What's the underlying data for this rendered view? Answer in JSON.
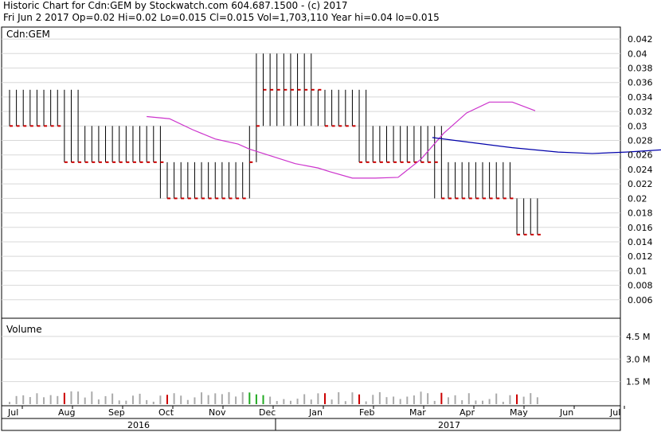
{
  "header": {
    "line1": "Historic Chart for Cdn:GEM by Stockwatch.com 604.687.1500 - (c) 2017",
    "line2": "Fri Jun  2 2017   Op=0.02   Hi=0.02   Lo=0.015   Cl=0.015   Vol=1,703,110   Year hi=0.04   lo=0.015"
  },
  "colors": {
    "price_up": "#000000",
    "price_close": "#cc0000",
    "ma_short": "#cc33cc",
    "ma_long": "#0000aa",
    "volume_flat": "#aaaaaa",
    "volume_up": "#22aa22",
    "volume_down": "#cc0000",
    "grid": "#d8d8d8"
  },
  "chart_data": {
    "type": "line",
    "price_panel": {
      "symbol": "Cdn:GEM",
      "ylim": [
        0.004,
        0.043
      ],
      "y_ticks": [
        "0.042",
        "0.04",
        "0.038",
        "0.036",
        "0.034",
        "0.032",
        "0.03",
        "0.028",
        "0.026",
        "0.024",
        "0.022",
        "0.02",
        "0.018",
        "0.016",
        "0.014",
        "0.012",
        "0.01",
        "0.008",
        "0.006"
      ],
      "price_bars": {
        "day_index": [
          0,
          3,
          6,
          9,
          12,
          15,
          18,
          21,
          24,
          27,
          30,
          33,
          36,
          39,
          42,
          45,
          48,
          51,
          54,
          57,
          60,
          63,
          66,
          69,
          72,
          75,
          78,
          81,
          84,
          87,
          90,
          93,
          96,
          99,
          102,
          105,
          108,
          111,
          114,
          117,
          120,
          123,
          126,
          129,
          132,
          135,
          138,
          141,
          144,
          147,
          150,
          153,
          156,
          159,
          162,
          165,
          168,
          171,
          174,
          177,
          180,
          183,
          186,
          189,
          192,
          195,
          198,
          201,
          204,
          207,
          210,
          213,
          216,
          219,
          222,
          225,
          228,
          231
        ],
        "low": [
          0.03,
          0.03,
          0.03,
          0.03,
          0.03,
          0.03,
          0.03,
          0.03,
          0.025,
          0.025,
          0.025,
          0.025,
          0.025,
          0.025,
          0.025,
          0.025,
          0.025,
          0.025,
          0.025,
          0.025,
          0.025,
          0.025,
          0.02,
          0.02,
          0.02,
          0.02,
          0.02,
          0.02,
          0.02,
          0.02,
          0.02,
          0.02,
          0.02,
          0.02,
          0.02,
          0.02,
          0.025,
          0.03,
          0.03,
          0.03,
          0.03,
          0.03,
          0.03,
          0.03,
          0.03,
          0.03,
          0.03,
          0.03,
          0.03,
          0.03,
          0.03,
          0.025,
          0.025,
          0.025,
          0.025,
          0.025,
          0.025,
          0.025,
          0.025,
          0.025,
          0.025,
          0.025,
          0.02,
          0.02,
          0.02,
          0.02,
          0.02,
          0.02,
          0.02,
          0.02,
          0.02,
          0.02,
          0.02,
          0.02,
          0.015,
          0.015,
          0.015,
          0.015
        ],
        "high": [
          0.035,
          0.035,
          0.035,
          0.035,
          0.035,
          0.035,
          0.035,
          0.035,
          0.035,
          0.035,
          0.035,
          0.03,
          0.03,
          0.03,
          0.03,
          0.03,
          0.03,
          0.03,
          0.03,
          0.03,
          0.03,
          0.03,
          0.03,
          0.025,
          0.025,
          0.025,
          0.025,
          0.025,
          0.025,
          0.025,
          0.025,
          0.025,
          0.025,
          0.025,
          0.025,
          0.03,
          0.04,
          0.04,
          0.04,
          0.04,
          0.04,
          0.04,
          0.04,
          0.04,
          0.04,
          0.035,
          0.035,
          0.035,
          0.035,
          0.035,
          0.035,
          0.035,
          0.035,
          0.03,
          0.03,
          0.03,
          0.03,
          0.03,
          0.03,
          0.03,
          0.03,
          0.03,
          0.03,
          0.03,
          0.025,
          0.025,
          0.025,
          0.025,
          0.025,
          0.025,
          0.025,
          0.025,
          0.025,
          0.025,
          0.02,
          0.02,
          0.02,
          0.02
        ],
        "close": [
          0.03,
          0.03,
          0.03,
          0.03,
          0.03,
          0.03,
          0.03,
          0.03,
          0.025,
          0.025,
          0.025,
          0.025,
          0.025,
          0.025,
          0.025,
          0.025,
          0.025,
          0.025,
          0.025,
          0.025,
          0.025,
          0.025,
          0.025,
          0.02,
          0.02,
          0.02,
          0.02,
          0.02,
          0.02,
          0.02,
          0.02,
          0.02,
          0.02,
          0.02,
          0.02,
          0.025,
          0.03,
          0.035,
          0.035,
          0.035,
          0.035,
          0.035,
          0.035,
          0.035,
          0.035,
          0.035,
          0.03,
          0.03,
          0.03,
          0.03,
          0.03,
          0.025,
          0.025,
          0.025,
          0.025,
          0.025,
          0.025,
          0.025,
          0.025,
          0.025,
          0.025,
          0.025,
          0.025,
          0.02,
          0.02,
          0.02,
          0.02,
          0.02,
          0.02,
          0.02,
          0.02,
          0.02,
          0.02,
          0.02,
          0.015,
          0.015,
          0.015,
          0.015
        ]
      },
      "moving_average_short": {
        "day_index": [
          60,
          70,
          80,
          90,
          100,
          105,
          115,
          125,
          135,
          140,
          150,
          160,
          170,
          180,
          190,
          200,
          210,
          220,
          230
        ],
        "values": [
          0.0313,
          0.031,
          0.0295,
          0.0282,
          0.0275,
          0.0268,
          0.0258,
          0.0248,
          0.0242,
          0.0237,
          0.0228,
          0.0228,
          0.0229,
          0.0254,
          0.029,
          0.0318,
          0.0333,
          0.0333,
          0.0321
        ]
      },
      "moving_average_long": {
        "day_index": [
          185,
          200,
          220,
          240,
          255,
          270,
          290,
          310,
          330,
          360,
          390,
          420,
          440
        ],
        "values": [
          0.0284,
          0.0278,
          0.027,
          0.0264,
          0.0262,
          0.0264,
          0.0268,
          0.0273,
          0.0278,
          0.0282,
          0.0286,
          0.0287,
          0.0284
        ]
      }
    },
    "volume_panel": {
      "label": "Volume",
      "ylim": [
        0,
        5500000
      ],
      "y_ticks": [
        "4.5 M",
        "3.0 M",
        "1.5 M"
      ],
      "y_tick_values": [
        4500000,
        3000000,
        1500000
      ]
    },
    "x_axis": {
      "months": [
        "Jul",
        "Aug",
        "Sep",
        "Oct",
        "Nov",
        "Dec",
        "Jan",
        "Feb",
        "Mar",
        "Apr",
        "May",
        "Jun",
        "Jul"
      ],
      "years": [
        "2016",
        "2017"
      ]
    }
  }
}
